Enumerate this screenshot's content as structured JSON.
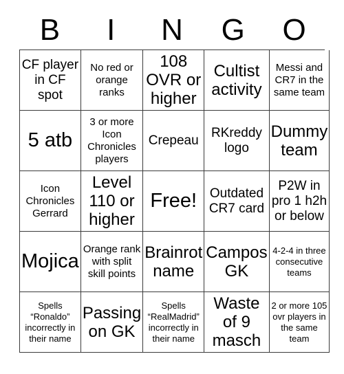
{
  "header": {
    "letters": [
      "B",
      "I",
      "N",
      "G",
      "O"
    ]
  },
  "grid": {
    "columns": 5,
    "rows": 5,
    "cells": [
      {
        "text": "CF player in CF spot",
        "size": "md",
        "free": false
      },
      {
        "text": "No red or orange ranks",
        "size": "sm",
        "free": false
      },
      {
        "text": "108 OVR or higher",
        "size": "lg",
        "free": false
      },
      {
        "text": "Cultist activity",
        "size": "lg",
        "free": false
      },
      {
        "text": "Messi and CR7 in the same team",
        "size": "sm",
        "free": false
      },
      {
        "text": "5 atb",
        "size": "xl",
        "free": false
      },
      {
        "text": "3 or more Icon Chronicles players",
        "size": "sm",
        "free": false
      },
      {
        "text": "Crepeau",
        "size": "md",
        "free": false
      },
      {
        "text": "RKreddy logo",
        "size": "md",
        "free": false
      },
      {
        "text": "Dummy team",
        "size": "lg",
        "free": false
      },
      {
        "text": "Icon Chronicles Gerrard",
        "size": "sm",
        "free": false
      },
      {
        "text": "Level 110 or higher",
        "size": "lg",
        "free": false
      },
      {
        "text": "Free!",
        "size": "xl",
        "free": true
      },
      {
        "text": "Outdated CR7 card",
        "size": "md",
        "free": false
      },
      {
        "text": "P2W in pro 1 h2h or below",
        "size": "md",
        "free": false
      },
      {
        "text": "Mojica",
        "size": "xl",
        "free": false
      },
      {
        "text": "Orange rank with split skill points",
        "size": "sm",
        "free": false
      },
      {
        "text": "Brainrot name",
        "size": "lg",
        "free": false
      },
      {
        "text": "Campos GK",
        "size": "lg",
        "free": false
      },
      {
        "text": "4-2-4 in three consecutive teams",
        "size": "xs",
        "free": false
      },
      {
        "text": "Spells “Ronaldo” incorrectly in their name",
        "size": "xs",
        "free": false
      },
      {
        "text": "Passing on GK",
        "size": "lg",
        "free": false
      },
      {
        "text": "Spells “RealMadrid” incorrectly in their name",
        "size": "xs",
        "free": false
      },
      {
        "text": "Waste of 9 masch",
        "size": "lg",
        "free": false
      },
      {
        "text": "2 or more 105 ovr players in the same team",
        "size": "xs",
        "free": false
      }
    ]
  },
  "colors": {
    "background": "#ffffff",
    "text": "#000000",
    "border": "#3a3a3a"
  }
}
